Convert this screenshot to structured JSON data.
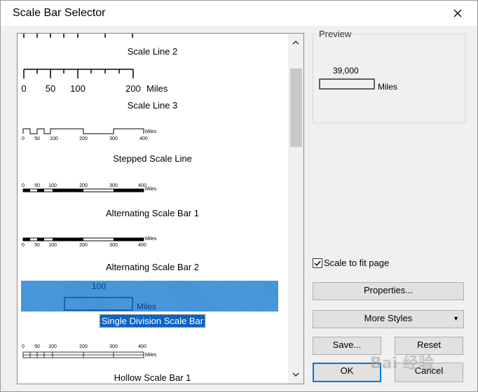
{
  "dialog": {
    "title": "Scale Bar Selector"
  },
  "list": {
    "items": [
      {
        "label": "Scale Line 2"
      },
      {
        "label": "Scale Line 3",
        "ticks": [
          "0",
          "50",
          "100",
          "200"
        ],
        "unit": "Miles"
      },
      {
        "label": "Stepped Scale Line",
        "ticks": [
          "0",
          "50",
          "100",
          "200",
          "300",
          "400"
        ],
        "unit": "Miles"
      },
      {
        "label": "Alternating Scale Bar 1",
        "ticks": [
          "0",
          "50",
          "100",
          "200",
          "300",
          "400"
        ],
        "unit": "Miles"
      },
      {
        "label": "Alternating Scale Bar 2",
        "ticks": [
          "0",
          "50",
          "100",
          "200",
          "300",
          "400"
        ],
        "unit": "Miles"
      },
      {
        "label": "Single Division Scale Bar",
        "value": "100",
        "unit": "Miles",
        "selected": true
      },
      {
        "label": "Hollow Scale Bar 1",
        "ticks": [
          "0",
          "50",
          "100",
          "200",
          "300",
          "400"
        ],
        "unit": "Miles"
      }
    ]
  },
  "preview": {
    "title": "Preview",
    "value": "39,000",
    "unit": "Miles"
  },
  "scale_to_fit": {
    "label": "Scale to fit page",
    "checked": true
  },
  "buttons": {
    "properties": "Properties...",
    "more_styles": "More Styles",
    "save": "Save...",
    "reset": "Reset",
    "ok": "OK",
    "cancel": "Cancel"
  },
  "watermark": "Bai 经验"
}
